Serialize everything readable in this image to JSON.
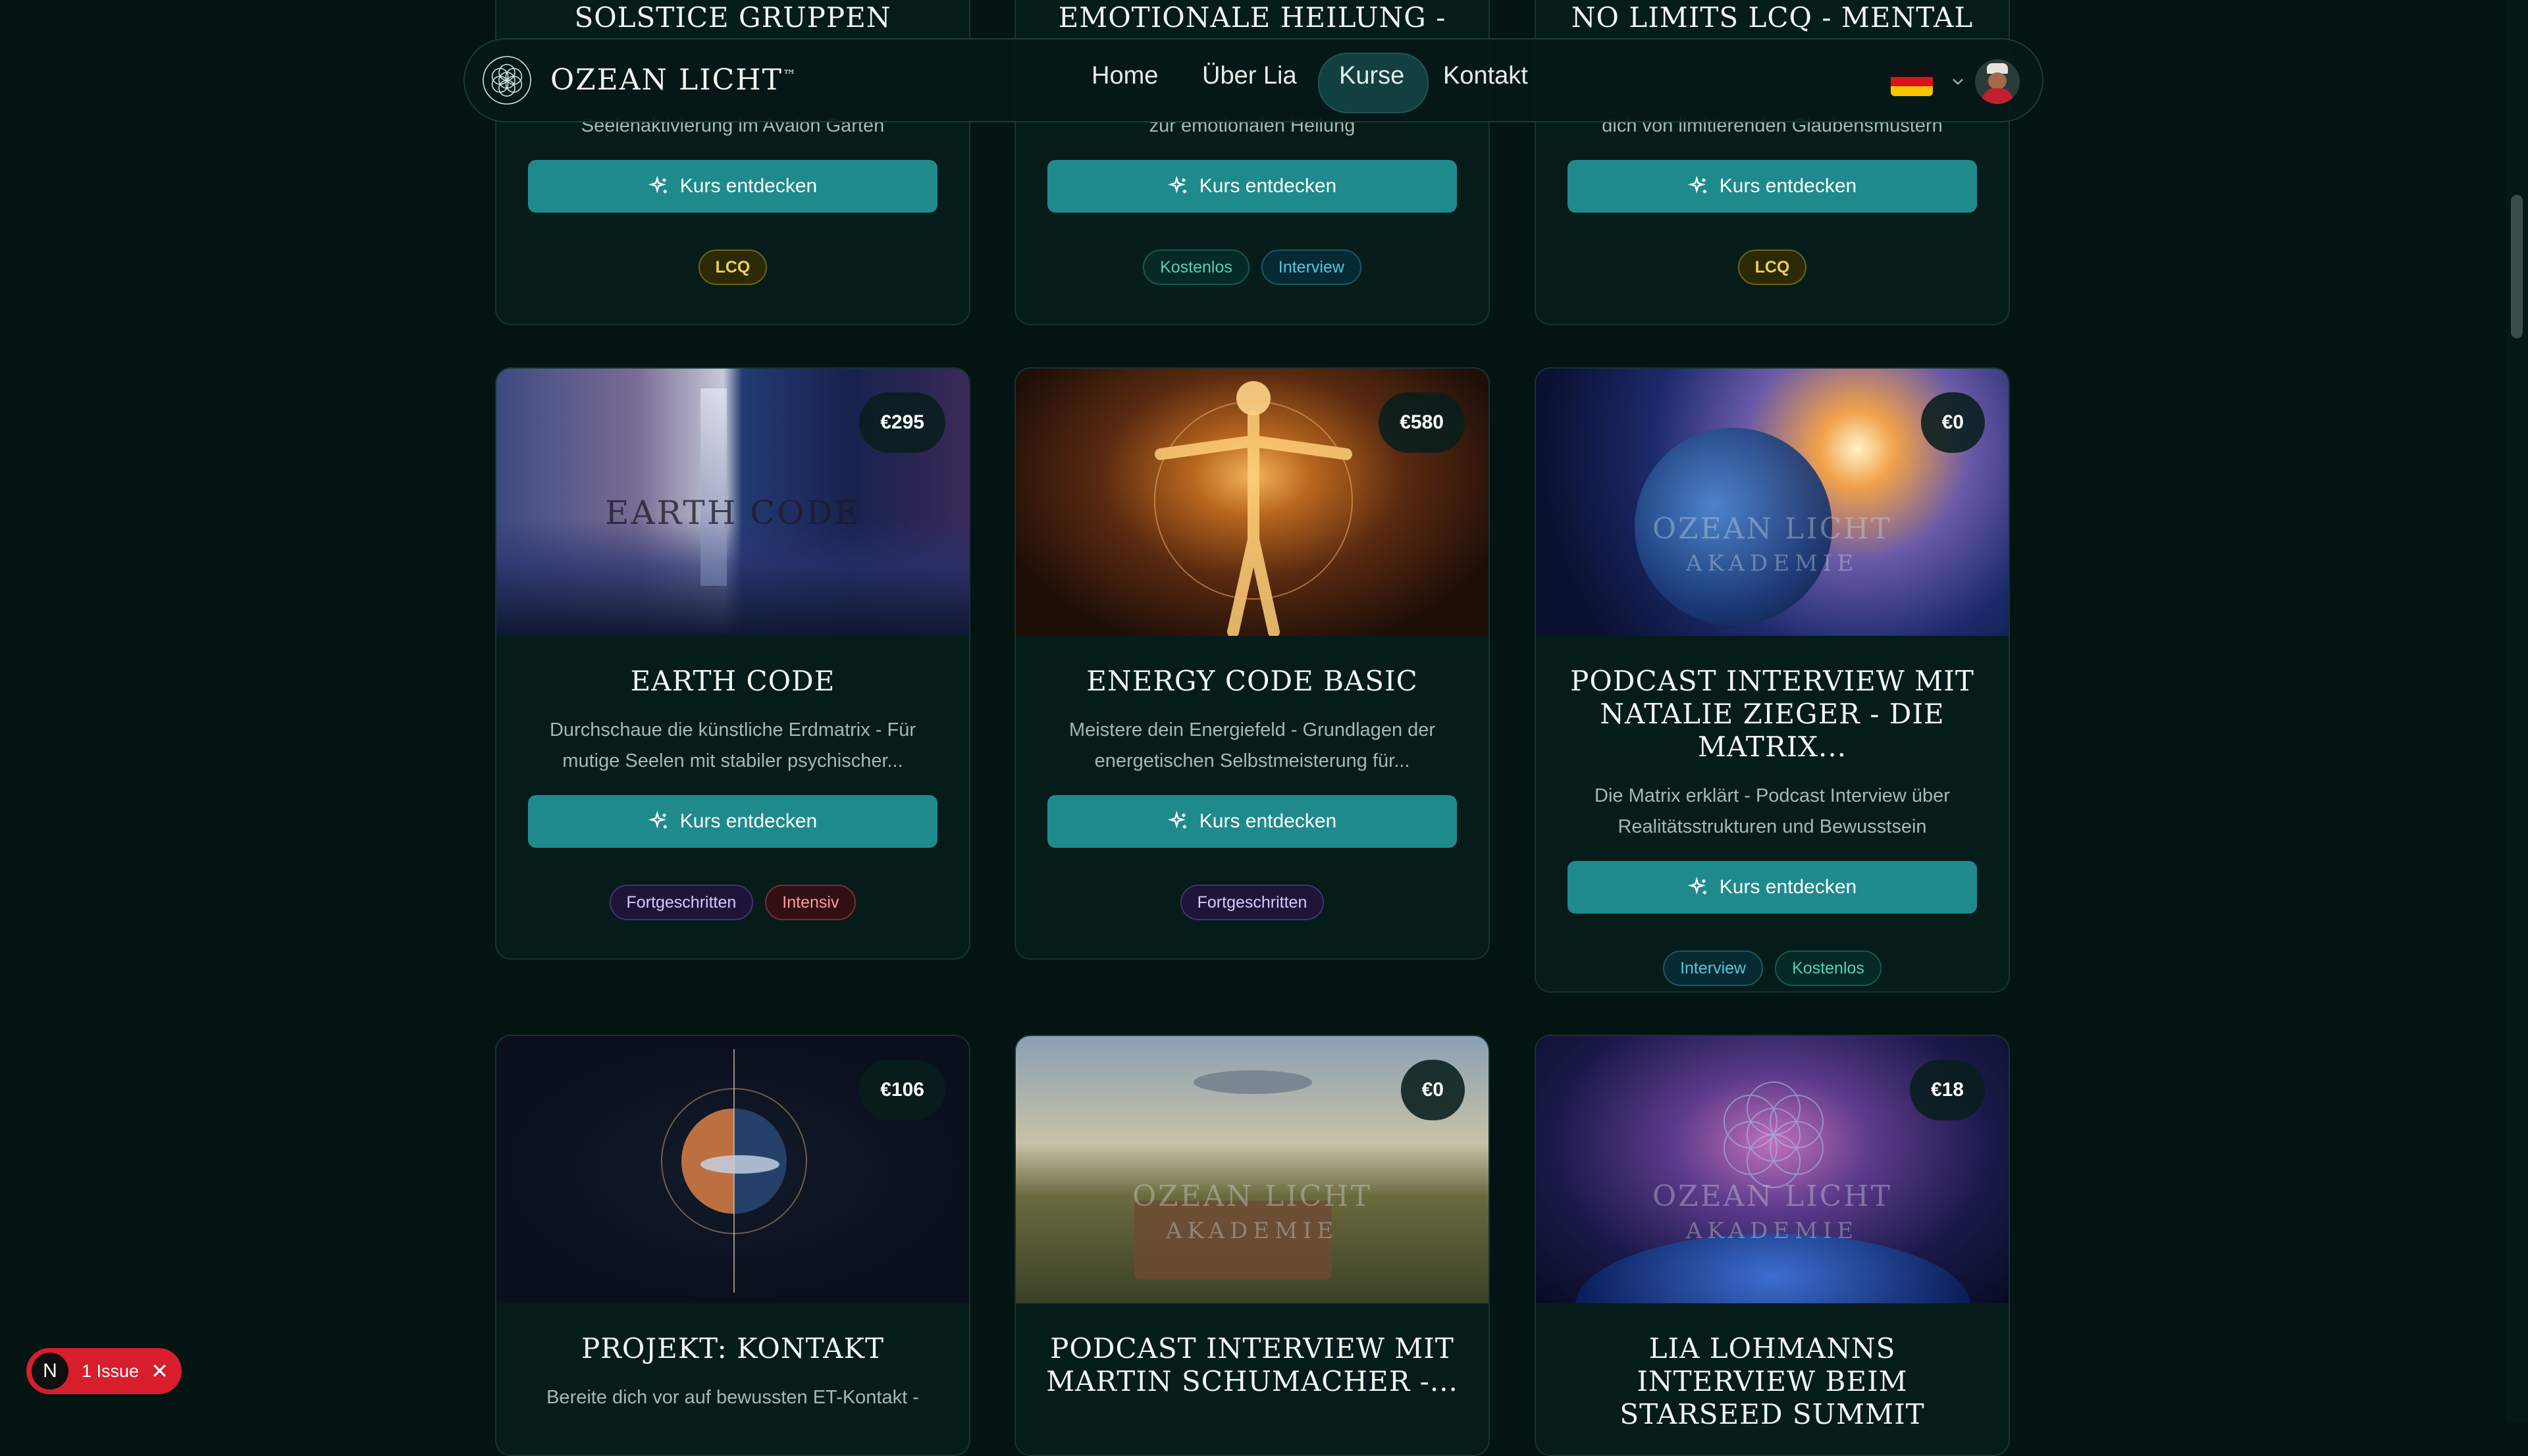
{
  "nav": {
    "brand": "OZEAN LICHT",
    "brand_tm": "™",
    "links": [
      "Home",
      "Über Lia",
      "Kurse",
      "Kontakt"
    ],
    "active": "Kurse",
    "language": "DE"
  },
  "colors": {
    "background": "#031412",
    "card": "#061c1b",
    "accent": "#1f8a8c",
    "issue": "#d81e2c"
  },
  "cta_label": "Kurs entdecken",
  "top_row": [
    {
      "title": "SOLSTICE GRUPPEN",
      "desc_tail": "Seelenaktivierung im Avalon Garten",
      "tags": [
        "LCQ"
      ]
    },
    {
      "title": "EMOTIONALE HEILUNG -",
      "desc_tail": "zur emotionalen Heilung",
      "tags": [
        "Kostenlos",
        "Interview"
      ]
    },
    {
      "title": "NO LIMITS LCQ - MENTAL",
      "desc_tail": "dich von limitierenden Glaubensmustern",
      "tags": [
        "LCQ"
      ]
    }
  ],
  "cards": [
    {
      "price": "€295",
      "image_text": "EARTH CODE",
      "title": "EARTH CODE",
      "desc": "Durchschaue die künstliche Erdmatrix - Für mutige Seelen mit stabiler psychischer...",
      "tags": [
        "Fortgeschritten",
        "Intensiv"
      ]
    },
    {
      "price": "€580",
      "title": "ENERGY CODE BASIC",
      "desc": "Meistere dein Energiefeld - Grundlagen der energetischen Selbstmeisterung für...",
      "tags": [
        "Fortgeschritten"
      ]
    },
    {
      "price": "€0",
      "image_text_1": "OZEAN LICHT",
      "image_text_2": "AKADEMIE",
      "title": "PODCAST INTERVIEW MIT NATALIE ZIEGER - DIE MATRIX...",
      "desc": "Die Matrix erklärt - Podcast Interview über Realitätsstrukturen und Bewusstsein",
      "tags": [
        "Interview",
        "Kostenlos"
      ]
    },
    {
      "price": "€106",
      "title": "PROJEKT: KONTAKT",
      "desc": "Bereite dich vor auf bewussten ET-Kontakt -"
    },
    {
      "price": "€0",
      "image_text_1": "OZEAN LICHT",
      "image_text_2": "AKADEMIE",
      "title": "PODCAST INTERVIEW MIT MARTIN SCHUMACHER -..."
    },
    {
      "price": "€18",
      "image_text_1": "OZEAN LICHT",
      "image_text_2": "AKADEMIE",
      "title": "LIA LOHMANNS INTERVIEW BEIM STARSEED SUMMIT"
    }
  ],
  "issue": {
    "letter": "N",
    "label": "1 Issue",
    "close": "✕"
  }
}
